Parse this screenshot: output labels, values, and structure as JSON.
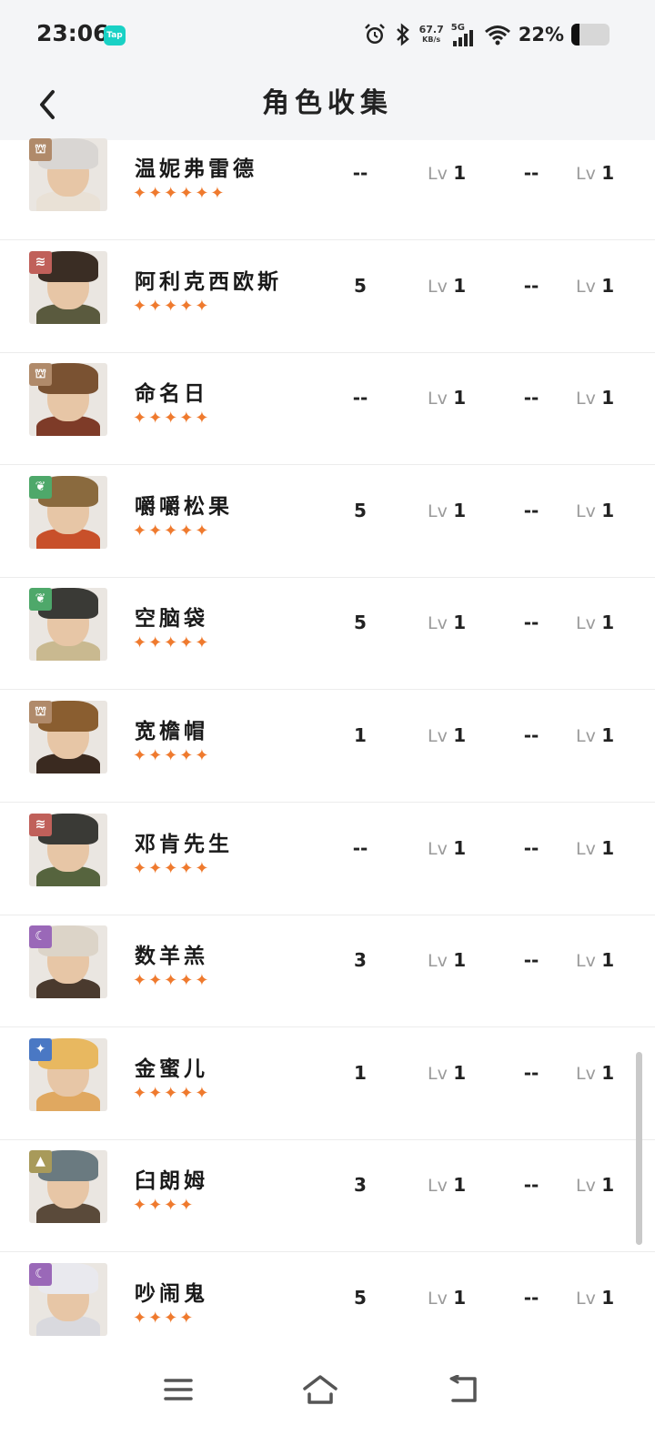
{
  "status": {
    "time": "23:06",
    "tap_badge": "Tap",
    "net_speed": "67.7",
    "net_unit": "KB/s",
    "signal_label": "5G",
    "battery_pct": "22%",
    "battery_level": 0.22,
    "icons": [
      "alarm-icon",
      "bluetooth-icon",
      "signal-icon",
      "wifi-icon",
      "battery-icon"
    ]
  },
  "header": {
    "title": "角色收集",
    "back_icon": "chevron-left-icon"
  },
  "rows": [
    {
      "name": "温妮弗雷德",
      "stars": "✦✦✦✦✦✦",
      "value1": "--",
      "lv_prefix": "Lv",
      "lv1": "1",
      "value3": "--",
      "lv2": "1",
      "element": "cyan-tower",
      "elem_color": "#b08a6a",
      "hair": "#d9d6d3",
      "body": "#e9e1d6"
    },
    {
      "name": "阿利克西欧斯",
      "stars": "✦✦✦✦✦",
      "value1": "5",
      "lv_prefix": "Lv",
      "lv1": "1",
      "value3": "--",
      "lv2": "1",
      "element": "beast",
      "elem_color": "#c0605a",
      "hair": "#3a2d24",
      "body": "#5a5a3e"
    },
    {
      "name": "命名日",
      "stars": "✦✦✦✦✦",
      "value1": "--",
      "lv_prefix": "Lv",
      "lv1": "1",
      "value3": "--",
      "lv2": "1",
      "element": "tower",
      "elem_color": "#b08a6a",
      "hair": "#7a5232",
      "body": "#7e3b28"
    },
    {
      "name": "嚼嚼松果",
      "stars": "✦✦✦✦✦",
      "value1": "5",
      "lv_prefix": "Lv",
      "lv1": "1",
      "value3": "--",
      "lv2": "1",
      "element": "plant",
      "elem_color": "#4ea86a",
      "hair": "#8a6a3e",
      "body": "#c8502a"
    },
    {
      "name": "空脑袋",
      "stars": "✦✦✦✦✦",
      "value1": "5",
      "lv_prefix": "Lv",
      "lv1": "1",
      "value3": "--",
      "lv2": "1",
      "element": "plant",
      "elem_color": "#4ea86a",
      "hair": "#3a3a36",
      "body": "#c9b990"
    },
    {
      "name": "宽檐帽",
      "stars": "✦✦✦✦✦",
      "value1": "1",
      "lv_prefix": "Lv",
      "lv1": "1",
      "value3": "--",
      "lv2": "1",
      "element": "tower",
      "elem_color": "#b08a6a",
      "hair": "#8a5e30",
      "body": "#3a2a20"
    },
    {
      "name": "邓肯先生",
      "stars": "✦✦✦✦✦",
      "value1": "--",
      "lv_prefix": "Lv",
      "lv1": "1",
      "value3": "--",
      "lv2": "1",
      "element": "beast",
      "elem_color": "#c0605a",
      "hair": "#3a3a36",
      "body": "#56643e"
    },
    {
      "name": "数羊羔",
      "stars": "✦✦✦✦✦",
      "value1": "3",
      "lv_prefix": "Lv",
      "lv1": "1",
      "value3": "--",
      "lv2": "1",
      "element": "moon",
      "elem_color": "#9a68b8",
      "hair": "#dcd4c8",
      "body": "#4a3a2e"
    },
    {
      "name": "金蜜儿",
      "stars": "✦✦✦✦✦",
      "value1": "1",
      "lv_prefix": "Lv",
      "lv1": "1",
      "value3": "--",
      "lv2": "1",
      "element": "star",
      "elem_color": "#4a78c4",
      "hair": "#e8b860",
      "body": "#e0a860"
    },
    {
      "name": "臼朗姆",
      "stars": "✦✦✦✦",
      "value1": "3",
      "lv_prefix": "Lv",
      "lv1": "1",
      "value3": "--",
      "lv2": "1",
      "element": "mineral",
      "elem_color": "#a89a5a",
      "hair": "#6a7a80",
      "body": "#5a4a3a"
    },
    {
      "name": "吵闹鬼",
      "stars": "✦✦✦✦",
      "value1": "5",
      "lv_prefix": "Lv",
      "lv1": "1",
      "value3": "--",
      "lv2": "1",
      "element": "moon",
      "elem_color": "#9a68b8",
      "hair": "#e9e9ee",
      "body": "#d9d9de"
    }
  ],
  "bottom_nav": {
    "icons": [
      "menu-icon",
      "home-icon",
      "back-arrow-icon"
    ]
  }
}
